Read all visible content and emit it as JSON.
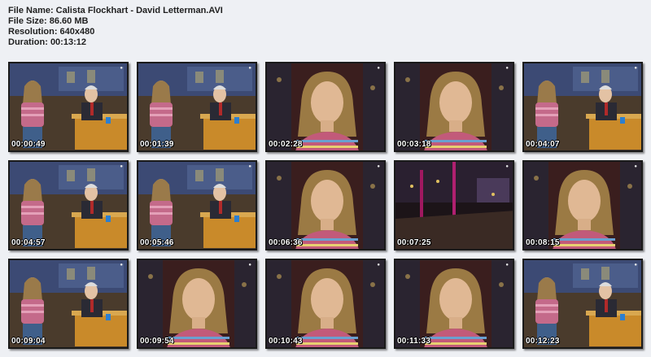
{
  "info": {
    "file_name": "File Name: Calista Flockhart - David Letterman.AVI",
    "file_size": "File Size: 86.60 MB",
    "resolution": "Resolution: 640x480",
    "duration": "Duration: 00:13:12"
  },
  "thumbnails": [
    {
      "timestamp": "00:00:49",
      "scene": "two-shot"
    },
    {
      "timestamp": "00:01:39",
      "scene": "two-shot"
    },
    {
      "timestamp": "00:02:28",
      "scene": "closeup"
    },
    {
      "timestamp": "00:03:18",
      "scene": "closeup"
    },
    {
      "timestamp": "00:04:07",
      "scene": "two-shot"
    },
    {
      "timestamp": "00:04:57",
      "scene": "two-shot"
    },
    {
      "timestamp": "00:05:46",
      "scene": "two-shot"
    },
    {
      "timestamp": "00:06:36",
      "scene": "closeup"
    },
    {
      "timestamp": "00:07:25",
      "scene": "stage"
    },
    {
      "timestamp": "00:08:15",
      "scene": "closeup"
    },
    {
      "timestamp": "00:09:04",
      "scene": "two-shot"
    },
    {
      "timestamp": "00:09:54",
      "scene": "closeup"
    },
    {
      "timestamp": "00:10:43",
      "scene": "closeup"
    },
    {
      "timestamp": "00:11:33",
      "scene": "closeup"
    },
    {
      "timestamp": "00:12:23",
      "scene": "two-shot"
    }
  ]
}
